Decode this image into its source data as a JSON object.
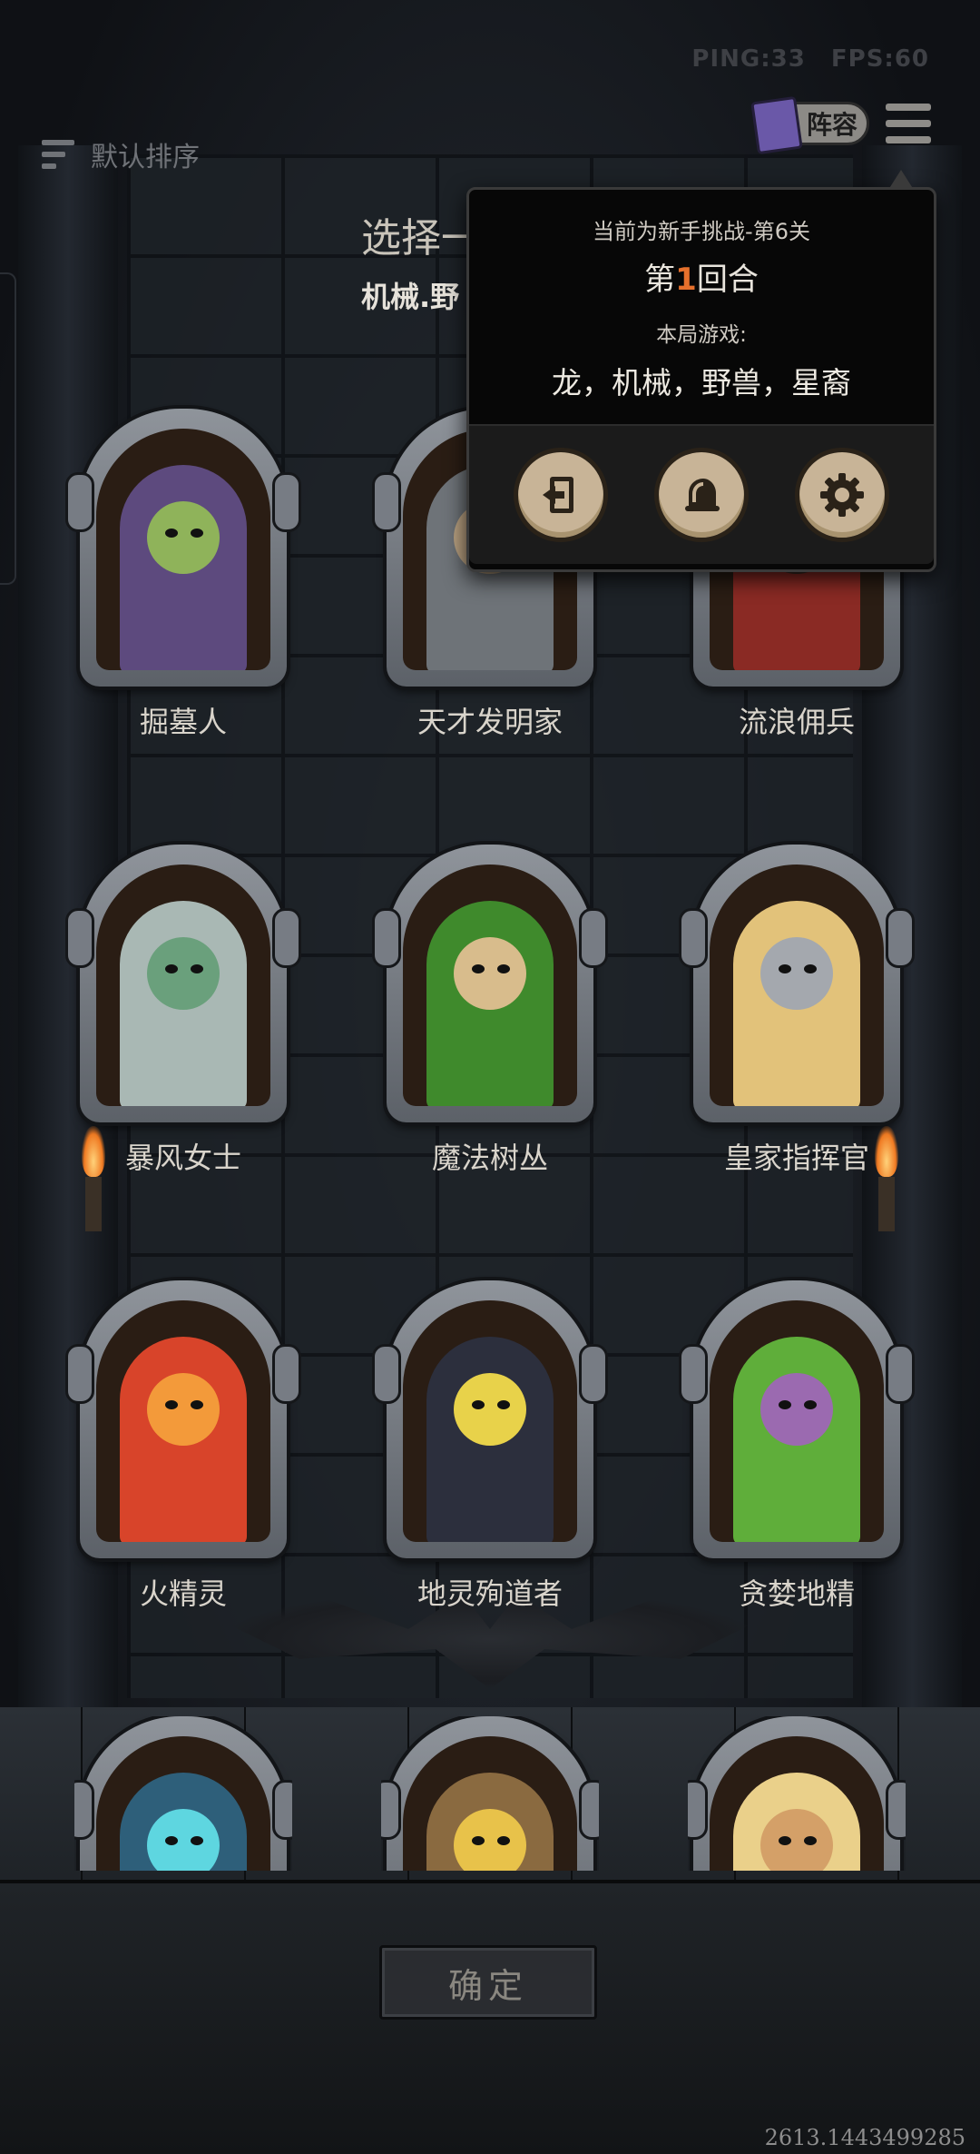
{
  "status": {
    "ping": "PING:33",
    "fps": "FPS:60"
  },
  "sort": {
    "label": "默认排序",
    "icon": "sort-icon"
  },
  "toolbar": {
    "lineup_label": "阵容",
    "lineup_icon": "spellbook-icon",
    "menu_icon": "hamburger-menu-icon"
  },
  "header": {
    "title": "选择一",
    "subtitle": "机械.野"
  },
  "popup": {
    "challenge": "当前为新手挑战-第6关",
    "round_prefix": "第",
    "round_number": "1",
    "round_suffix": "回合",
    "types_label": "本局游戏:",
    "types": "龙，机械，野兽，星裔",
    "buttons": [
      {
        "name": "exit-button",
        "icon": "exit-door-icon"
      },
      {
        "name": "tips-button",
        "icon": "bell-icon"
      },
      {
        "name": "settings-button",
        "icon": "gear-icon"
      }
    ]
  },
  "heroes": [
    {
      "name": "掘墓人",
      "colors": [
        "#5d4a7e",
        "#8fb35a"
      ]
    },
    {
      "name": "天才发明家",
      "colors": [
        "#6e7378",
        "#b8a080"
      ]
    },
    {
      "name": "流浪佣兵",
      "colors": [
        "#8a2a24",
        "#3b2a22"
      ]
    },
    {
      "name": "暴风女士",
      "colors": [
        "#a9b8b4",
        "#6aa07c"
      ]
    },
    {
      "name": "魔法树丛",
      "colors": [
        "#3f8a2c",
        "#d8bc8c"
      ]
    },
    {
      "name": "皇家指挥官",
      "colors": [
        "#e2c27a",
        "#a4a8ae"
      ]
    },
    {
      "name": "火精灵",
      "colors": [
        "#d8442a",
        "#f39a3a"
      ]
    },
    {
      "name": "地灵殉道者",
      "colors": [
        "#2c2f3d",
        "#e8d24a"
      ]
    },
    {
      "name": "贪婪地精",
      "colors": [
        "#5fae3a",
        "#9b6ab0"
      ]
    },
    {
      "name": "",
      "colors": [
        "#2e5f7a",
        "#5ed6e0"
      ]
    },
    {
      "name": "",
      "colors": [
        "#8a6a40",
        "#e8c24a"
      ]
    },
    {
      "name": "",
      "colors": [
        "#ead08a",
        "#d4a068"
      ]
    }
  ],
  "confirm": {
    "label": "确定"
  },
  "coordinates": "2613.1443499285"
}
